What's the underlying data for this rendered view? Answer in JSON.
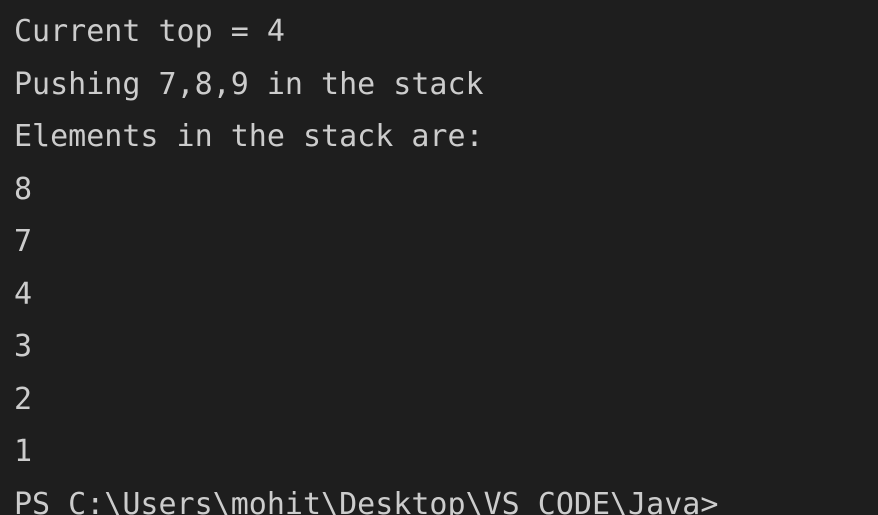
{
  "terminal": {
    "lines": [
      "Current top = 4",
      "Pushing 7,8,9 in the stack",
      "Elements in the stack are:",
      "8",
      "7",
      "4",
      "3",
      "2",
      "1",
      "PS C:\\Users\\mohit\\Desktop\\VS CODE\\Java>"
    ]
  },
  "colors": {
    "background": "#1e1e1e",
    "text": "#cccccc"
  }
}
